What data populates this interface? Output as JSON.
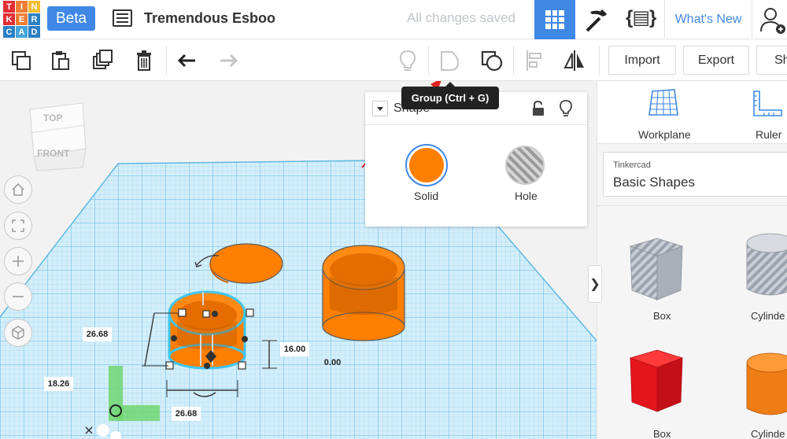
{
  "app": {
    "logo_letters": [
      "T",
      "I",
      "N",
      "K",
      "E",
      "R",
      "C",
      "A",
      "D"
    ],
    "logo_colors": [
      "#e22e33",
      "#ef7d35",
      "#f5bb32",
      "#e22e33",
      "#ef7d35",
      "#2b7fc3",
      "#2b7fc3",
      "#44a5dc",
      "#2b7fc3"
    ],
    "beta_label": "Beta",
    "design_title": "Tremendous Esboo",
    "save_status": "All changes saved",
    "whats_new": "What's New"
  },
  "toolbar": {
    "import_label": "Import",
    "export_label": "Export",
    "share_label": "Sh"
  },
  "tooltip": {
    "text": "Group (Ctrl + G)"
  },
  "view_cube": {
    "top_label": "TOP",
    "front_label": "FRONT"
  },
  "shape_panel": {
    "title": "Shape",
    "solid_label": "Solid",
    "hole_label": "Hole",
    "solid_color": "#ff7f00"
  },
  "dimensions": {
    "height": "26.68",
    "z": "16.00",
    "elev": "0.00",
    "y": "18.26",
    "x": "26.68"
  },
  "right_panel": {
    "workplane_label": "Workplane",
    "ruler_label": "Ruler",
    "library_vendor": "Tinkercad",
    "library_name": "Basic Shapes",
    "shapes": [
      {
        "label": "Box",
        "color": "#aeb4bd"
      },
      {
        "label": "Cylinde",
        "color": "#aeb4bd"
      },
      {
        "label": "Box",
        "color": "#e3161e"
      },
      {
        "label": "Cylinde",
        "color": "#ee7d15"
      }
    ]
  },
  "colors": {
    "accent": "#3f88e6",
    "object_orange": "#ff7f00",
    "grid_blue": "#7cc8ec"
  }
}
